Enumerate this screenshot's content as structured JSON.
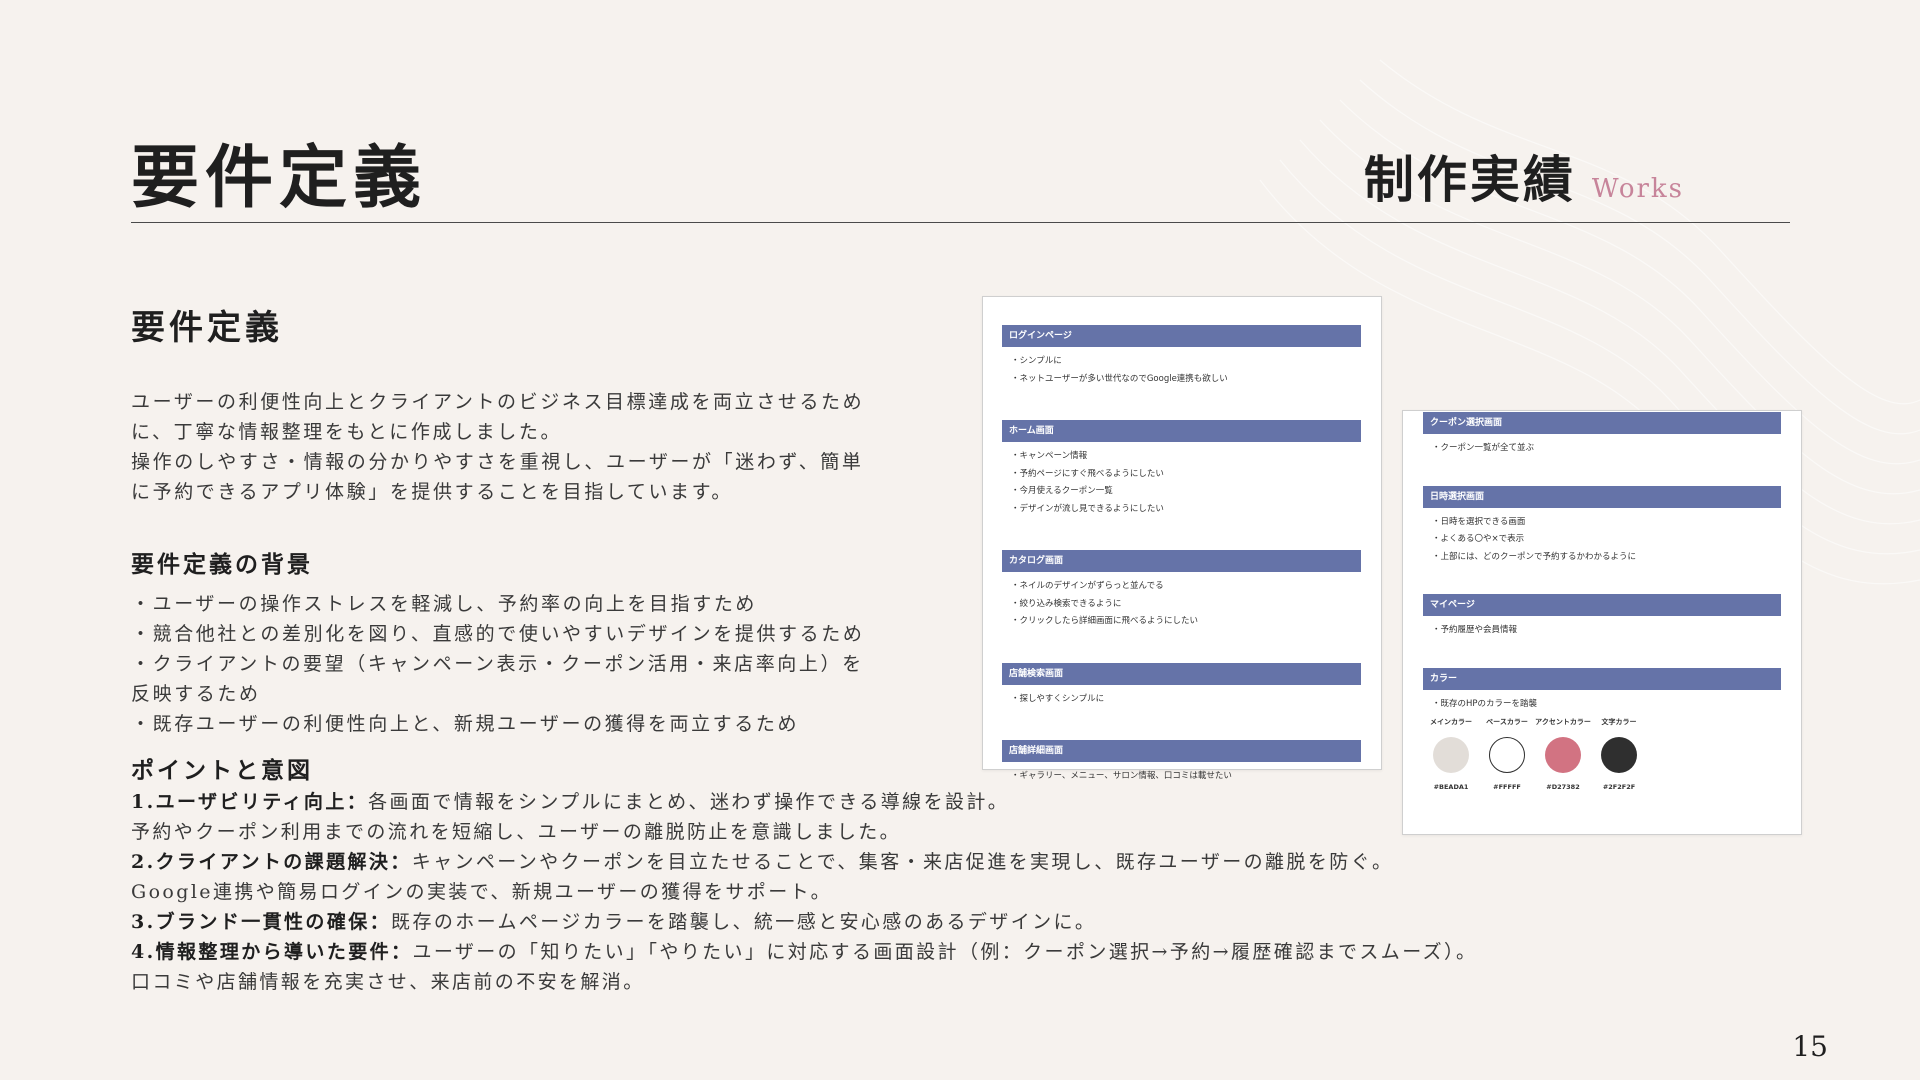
{
  "header": {
    "title": "要件定義",
    "section_jp": "制作実績",
    "section_en": "Works"
  },
  "content": {
    "heading": "要件定義",
    "intro": [
      "ユーザーの利便性向上とクライアントのビジネス目標達成を両立させるため",
      "に、丁寧な情報整理をもとに作成しました。",
      "操作のしやすさ・情報の分かりやすさを重視し、ユーザーが「迷わず、簡単",
      "に予約できるアプリ体験」を提供することを目指しています。"
    ],
    "background_heading": "要件定義の背景",
    "background_items": [
      "・ユーザーの操作ストレスを軽減し、予約率の向上を目指すため",
      "・競合他社との差別化を図り、直感的で使いやすいデザインを提供するため",
      "・クライアントの要望（キャンペーン表示・クーポン活用・来店率向上）を",
      "反映するため",
      "・既存ユーザーの利便性向上と、新規ユーザーの獲得を両立するため"
    ],
    "points_heading": "ポイントと意図",
    "points": [
      {
        "label": "1.ユーザビリティ向上：",
        "text": "各画面で情報をシンプルにまとめ、迷わず操作できる導線を設計。"
      },
      {
        "label": "",
        "text": "予約やクーポン利用までの流れを短縮し、ユーザーの離脱防止を意識しました。"
      },
      {
        "label": "2.クライアントの課題解決：",
        "text": "キャンペーンやクーポンを目立たせることで、集客・来店促進を実現し、既存ユーザーの離脱を防ぐ。"
      },
      {
        "label": "",
        "text": "Google連携や簡易ログインの実装で、新規ユーザーの獲得をサポート。"
      },
      {
        "label": "3.ブランド一貫性の確保：",
        "text": "既存のホームページカラーを踏襲し、統一感と安心感のあるデザインに。"
      },
      {
        "label": "4.情報整理から導いた要件：",
        "text": "ユーザーの「知りたい」「やりたい」に対応する画面設計（例：クーポン選択→予約→履歴確認までスムーズ）。"
      },
      {
        "label": "",
        "text": "口コミや店舗情報を充実させ、来店前の不安を解消。"
      }
    ]
  },
  "spec_card_1": [
    {
      "title": "ログインページ",
      "items": [
        "・シンプルに",
        "・ネットユーザーが多い世代なのでGoogle連携も欲しい"
      ]
    },
    {
      "title": "ホーム画面",
      "items": [
        "・キャンペーン情報",
        "・予約ページにすぐ飛べるようにしたい",
        "・今月使えるクーポン一覧",
        "・デザインが流し見できるようにしたい"
      ]
    },
    {
      "title": "カタログ画面",
      "items": [
        "・ネイルのデザインがずらっと並んでる",
        "・絞り込み検索できるように",
        "・クリックしたら詳細画面に飛べるようにしたい"
      ]
    },
    {
      "title": "店舗検索画面",
      "items": [
        "・探しやすくシンプルに"
      ]
    },
    {
      "title": "店舗詳細画面",
      "items": [
        "・ギャラリー、メニュー、サロン情報、口コミは載せたい"
      ]
    }
  ],
  "spec_card_2": [
    {
      "title": "クーポン選択画面",
      "items": [
        "・クーポン一覧が全て並ぶ"
      ]
    },
    {
      "title": "日時選択画面",
      "items": [
        "・日時を選択できる画面",
        "・よくある〇や×で表示",
        "・上部には、どのクーポンで予約するかわかるように"
      ]
    },
    {
      "title": "マイページ",
      "items": [
        "・予約履歴や会員情報"
      ]
    },
    {
      "title": "カラー",
      "items": [
        "・既存のHPのカラーを踏襲"
      ]
    }
  ],
  "colors": [
    {
      "label": "メインカラー",
      "hex": "#BEADA1",
      "color": "#e2ddd8"
    },
    {
      "label": "ベースカラー",
      "hex": "#FFFFF",
      "color": "#ffffff"
    },
    {
      "label": "アクセントカラー",
      "hex": "#D27382",
      "color": "#d27382"
    },
    {
      "label": "文字カラー",
      "hex": "#2F2F2F",
      "color": "#2f2f2f"
    }
  ],
  "page_number": "15"
}
